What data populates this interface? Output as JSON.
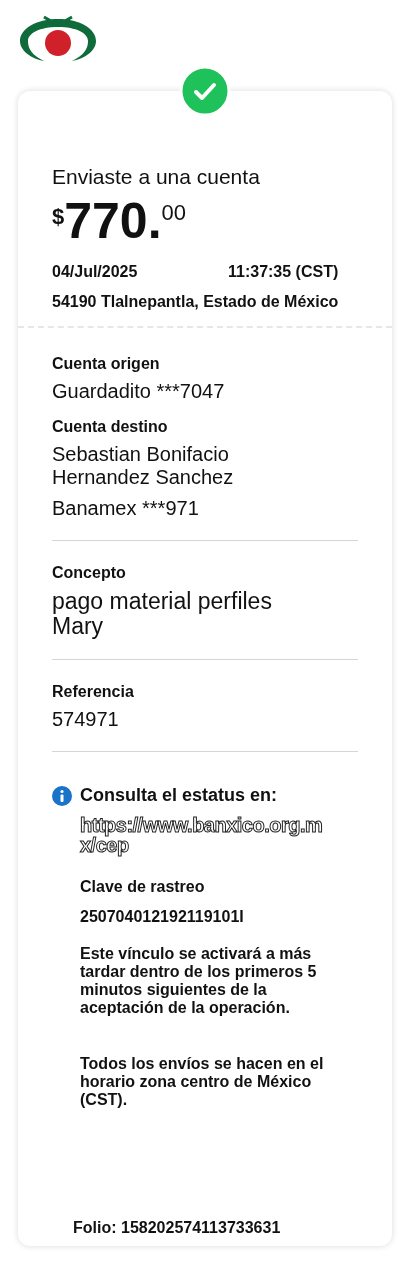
{
  "title": "Enviaste a una cuenta",
  "amount": {
    "currency": "$",
    "whole": "770.",
    "cents": "00"
  },
  "date": "04/Jul/2025",
  "time": "11:37:35 (CST)",
  "location": "54190 Tlalnepantla, Estado de México",
  "sections": [
    {
      "fields": [
        {
          "label": "Cuenta origen",
          "values": [
            "Guardadito ***7047"
          ],
          "kind": "plain"
        },
        {
          "label": "Cuenta destino",
          "values": [
            "Sebastian Bonifacio Hernandez Sanchez",
            "Banamex ***971"
          ],
          "kind": "plain"
        }
      ]
    },
    {
      "fields": [
        {
          "label": "Concepto",
          "values": [
            "pago material perfiles Mary"
          ],
          "kind": "concept"
        }
      ]
    },
    {
      "fields": [
        {
          "label": "Referencia",
          "values": [
            "574971"
          ],
          "kind": "plain"
        }
      ]
    }
  ],
  "status_info": {
    "heading": "Consulta el estatus en:",
    "link": "https://www.banxico.org.mx/cep",
    "tracking_label": "Clave de rastreo",
    "tracking_key": "250704012192119101I",
    "notes": [
      "Este vínculo se activará a más tardar dentro de los primeros 5 minutos siguientes de la aceptación de la operación.",
      "Todos los envíos se hacen en el horario zona centro de México (CST)."
    ]
  },
  "folio": "Folio: 158202574113733631"
}
